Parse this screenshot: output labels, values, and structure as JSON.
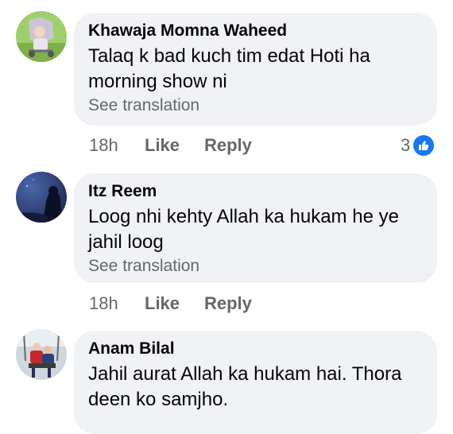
{
  "comments": [
    {
      "author": "Khawaja Momna Waheed",
      "text_line1": "Talaq k bad kuch tim edat Hoti ha",
      "text_line2": "morning show ni",
      "translation_link": "See translation",
      "time": "18h",
      "like_label": "Like",
      "reply_label": "Reply",
      "reaction_count": "3",
      "reaction_icon": "thumbs-up-icon"
    },
    {
      "author": "Itz Reem",
      "text_line1": "Loog nhi kehty Allah ka hukam he ye",
      "text_line2": "jahil loog",
      "translation_link": "See translation",
      "time": "18h",
      "like_label": "Like",
      "reply_label": "Reply"
    },
    {
      "author": "Anam Bilal",
      "text_line1": "Jahil aurat Allah ka hukam hai. Thora",
      "text_line2": "deen ko samjho."
    }
  ],
  "colors": {
    "bubble": "#f0f2f5",
    "secondary_text": "#65676b",
    "like_blue": "#1877f2"
  }
}
